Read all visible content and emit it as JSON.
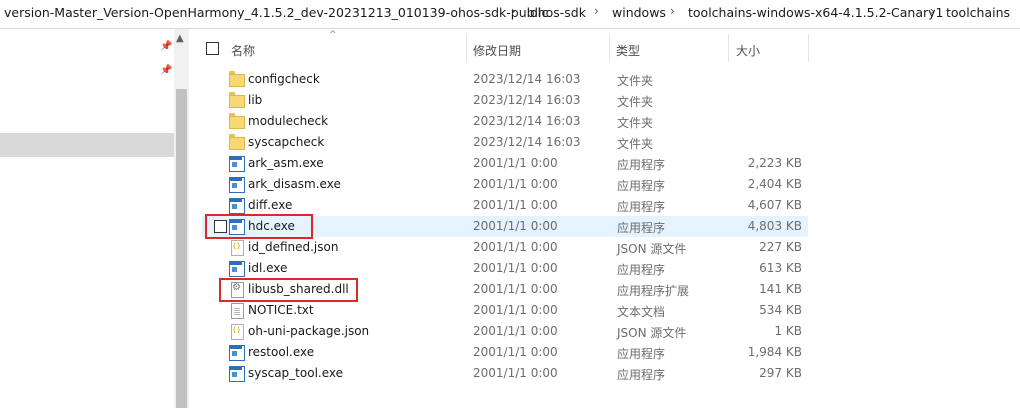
{
  "breadcrumb": [
    "version-Master_Version-OpenHarmony_4.1.5.2_dev-20231213_010139-ohos-sdk-public",
    "ohos-sdk",
    "windows",
    "toolchains-windows-x64-4.1.5.2-Canary1",
    "toolchains"
  ],
  "breadcrumb_separator": "›",
  "columns": {
    "name": "名称",
    "date": "修改日期",
    "type": "类型",
    "size": "大小"
  },
  "files": [
    {
      "name": "configcheck",
      "date": "2023/12/14 16:03",
      "type": "文件夹",
      "size": "",
      "icon": "folder-icon"
    },
    {
      "name": "lib",
      "date": "2023/12/14 16:03",
      "type": "文件夹",
      "size": "",
      "icon": "folder-icon"
    },
    {
      "name": "modulecheck",
      "date": "2023/12/14 16:03",
      "type": "文件夹",
      "size": "",
      "icon": "folder-icon"
    },
    {
      "name": "syscapcheck",
      "date": "2023/12/14 16:03",
      "type": "文件夹",
      "size": "",
      "icon": "folder-icon"
    },
    {
      "name": "ark_asm.exe",
      "date": "2001/1/1 0:00",
      "type": "应用程序",
      "size": "2,223 KB",
      "icon": "exe-icon"
    },
    {
      "name": "ark_disasm.exe",
      "date": "2001/1/1 0:00",
      "type": "应用程序",
      "size": "2,404 KB",
      "icon": "exe-icon"
    },
    {
      "name": "diff.exe",
      "date": "2001/1/1 0:00",
      "type": "应用程序",
      "size": "4,607 KB",
      "icon": "exe-icon"
    },
    {
      "name": "hdc.exe",
      "date": "2001/1/1 0:00",
      "type": "应用程序",
      "size": "4,803 KB",
      "icon": "exe-icon"
    },
    {
      "name": "id_defined.json",
      "date": "2001/1/1 0:00",
      "type": "JSON 源文件",
      "size": "227 KB",
      "icon": "json-file-icon"
    },
    {
      "name": "idl.exe",
      "date": "2001/1/1 0:00",
      "type": "应用程序",
      "size": "613 KB",
      "icon": "exe-icon"
    },
    {
      "name": "libusb_shared.dll",
      "date": "2001/1/1 0:00",
      "type": "应用程序扩展",
      "size": "141 KB",
      "icon": "dll-icon"
    },
    {
      "name": "NOTICE.txt",
      "date": "2001/1/1 0:00",
      "type": "文本文档",
      "size": "534 KB",
      "icon": "text-file-icon"
    },
    {
      "name": "oh-uni-package.json",
      "date": "2001/1/1 0:00",
      "type": "JSON 源文件",
      "size": "1 KB",
      "icon": "json-file-icon"
    },
    {
      "name": "restool.exe",
      "date": "2001/1/1 0:00",
      "type": "应用程序",
      "size": "1,984 KB",
      "icon": "exe-icon"
    },
    {
      "name": "syscap_tool.exe",
      "date": "2001/1/1 0:00",
      "type": "应用程序",
      "size": "297 KB",
      "icon": "exe-icon"
    }
  ],
  "hovered_file": "hdc.exe",
  "highlighted_files": [
    "hdc.exe",
    "libusb_shared.dll"
  ],
  "colors": {
    "highlight_box": "#e0262a",
    "hover_row": "#e5f3ff",
    "nav_selected": "#d9d9d9"
  }
}
